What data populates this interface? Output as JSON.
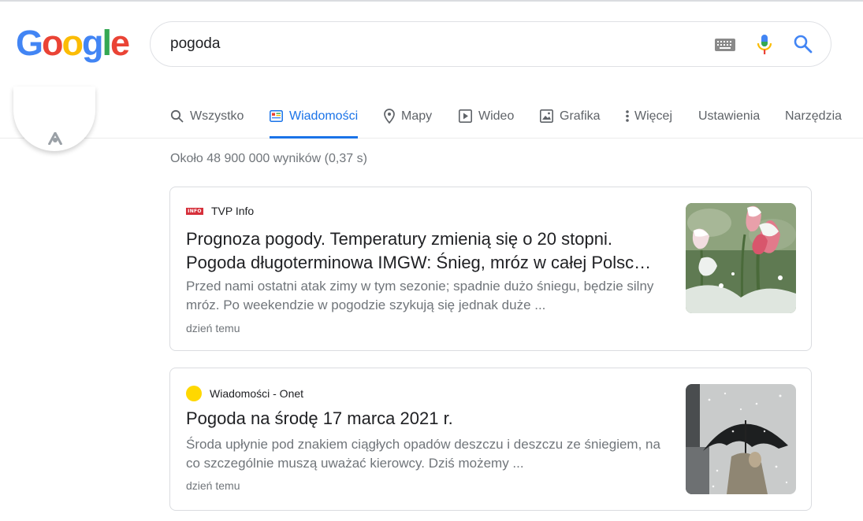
{
  "logo": {
    "text": "Google",
    "letters": [
      "G",
      "o",
      "o",
      "g",
      "l",
      "e"
    ],
    "colors": [
      "#4285f4",
      "#ea4335",
      "#fbbc05",
      "#4285f4",
      "#34a853",
      "#ea4335"
    ]
  },
  "search": {
    "query": "pogoda"
  },
  "tabs": [
    {
      "label": "Wszystko",
      "icon": "search-icon",
      "active": false
    },
    {
      "label": "Wiadomości",
      "icon": "news-icon",
      "active": true
    },
    {
      "label": "Mapy",
      "icon": "map-pin-icon",
      "active": false
    },
    {
      "label": "Wideo",
      "icon": "video-icon",
      "active": false
    },
    {
      "label": "Grafika",
      "icon": "image-icon",
      "active": false
    },
    {
      "label": "Więcej",
      "icon": "more-vert-icon",
      "active": false
    },
    {
      "label": "Ustawienia",
      "active": false
    },
    {
      "label": "Narzędzia",
      "active": false
    }
  ],
  "stats": "Około 48 900 000 wyników (0,37 s)",
  "results": [
    {
      "source": "TVP Info",
      "source_logo_text": "INFO",
      "title_lines": [
        "Prognoza pogody. Temperatury zmienią się o 20 stopni.",
        "Pogoda długoterminowa IMGW: Śnieg, mróz w całej Polsc…"
      ],
      "snippet": "Przed nami ostatni atak zimy w tym sezonie; spadnie dużo śniegu, będzie silny mróz. Po weekendzie w pogodzie szykują się jednak duże ...",
      "time": "dzień temu",
      "thumbnail": "snowy-tulips-image"
    },
    {
      "source": "Wiadomości - Onet",
      "title_lines": [
        "Pogoda na środę 17 marca 2021 r."
      ],
      "snippet": "Środa upłynie pod znakiem ciągłych opadów deszczu i deszczu ze śniegiem, na co szczególnie muszą uważać kierowcy. Dziś możemy ...",
      "time": "dzień temu",
      "thumbnail": "umbrella-in-snow-image"
    }
  ],
  "colors": {
    "accent": "#1a73e8",
    "tvp_red": "#d6303b",
    "onet_yellow": "#ffd800"
  }
}
